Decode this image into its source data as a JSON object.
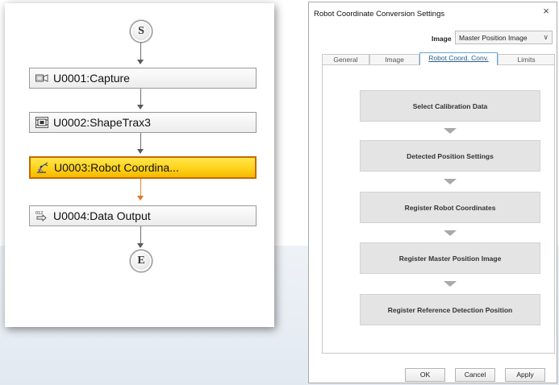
{
  "flow": {
    "start_node": "S",
    "end_node": "E",
    "units": [
      {
        "label": "U0001:Capture",
        "icon": "camera-icon"
      },
      {
        "label": "U0002:ShapeTrax3",
        "icon": "shape-trax-icon"
      },
      {
        "label": "U0003:Robot Coordina...",
        "icon": "robot-arm-icon",
        "selected": true
      },
      {
        "label": "U0004:Data Output",
        "icon": "data-output-icon"
      }
    ],
    "selected_color": "#ffd21a",
    "selected_border": "#c46a00"
  },
  "dialog": {
    "title": "Robot Coordinate Conversion Settings",
    "close_glyph": "×",
    "image_label": "Image",
    "image_value": "Master Position Image",
    "tabs": [
      {
        "label": "General",
        "active": false
      },
      {
        "label": "Image",
        "active": false
      },
      {
        "label": "Robot Coord. Conv.",
        "active": true
      },
      {
        "label": "Limits",
        "active": false
      }
    ],
    "steps": [
      "Select Calibration Data",
      "Detected Position Settings",
      "Register Robot Coordinates",
      "Register Master Position Image",
      "Register Reference Detection Position"
    ],
    "buttons": {
      "ok": "OK",
      "cancel": "Cancel",
      "apply": "Apply"
    },
    "accent": "#6aa6d6"
  }
}
